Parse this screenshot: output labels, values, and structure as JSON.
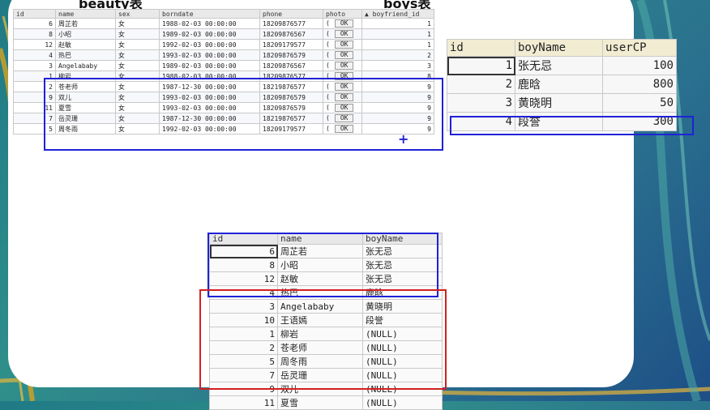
{
  "colors": {
    "highlight_blue": "#1f22d6",
    "highlight_red": "#d42020",
    "marker": "#1f22d6"
  },
  "captions": {
    "beauty": "beauty表",
    "boys": "boys表"
  },
  "beauty_table": {
    "headers": [
      "id",
      "name",
      "sex",
      "borndate",
      "phone",
      "photo",
      "boyfriend_id"
    ],
    "sort_indicator": "▲",
    "photo_button": "OK",
    "photo_prefix": "(",
    "rows": [
      [
        "6",
        "周芷若",
        "女",
        "1988-02-03 00:00:00",
        "18209876577",
        "1"
      ],
      [
        "8",
        "小昭",
        "女",
        "1989-02-03 00:00:00",
        "18209876567",
        "1"
      ],
      [
        "12",
        "赵敏",
        "女",
        "1992-02-03 00:00:00",
        "18209179577",
        "1"
      ],
      [
        "4",
        "热巴",
        "女",
        "1993-02-03 00:00:00",
        "18209876579",
        "2"
      ],
      [
        "3",
        "Angelababy",
        "女",
        "1989-02-03 00:00:00",
        "18209876567",
        "3"
      ],
      [
        "1",
        "柳岩",
        "女",
        "1988-02-03 00:00:00",
        "18209876577",
        "8"
      ],
      [
        "2",
        "苍老师",
        "女",
        "1987-12-30 00:00:00",
        "18219876577",
        "9"
      ],
      [
        "9",
        "双儿",
        "女",
        "1993-02-03 00:00:00",
        "18209876579",
        "9"
      ],
      [
        "11",
        "夏雪",
        "女",
        "1993-02-03 00:00:00",
        "18209876579",
        "9"
      ],
      [
        "7",
        "岳灵珊",
        "女",
        "1987-12-30 00:00:00",
        "18219876577",
        "9"
      ],
      [
        "5",
        "周冬雨",
        "女",
        "1992-02-03 00:00:00",
        "18209179577",
        "9"
      ]
    ],
    "marker": "+"
  },
  "boys_table": {
    "headers": [
      "id",
      "boyName",
      "userCP"
    ],
    "rows": [
      [
        "1",
        "张无忌",
        "100"
      ],
      [
        "2",
        "鹿晗",
        "800"
      ],
      [
        "3",
        "黄晓明",
        "50"
      ],
      [
        "4",
        "段誉",
        "300"
      ]
    ]
  },
  "result_table": {
    "headers": [
      "id",
      "name",
      "boyName"
    ],
    "rows": [
      [
        "6",
        "周芷若",
        "张无忌"
      ],
      [
        "8",
        "小昭",
        "张无忌"
      ],
      [
        "12",
        "赵敏",
        "张无忌"
      ],
      [
        "4",
        "热巴",
        "鹿晗"
      ],
      [
        "3",
        "Angelababy",
        "黄晓明"
      ],
      [
        "10",
        "王语嫣",
        "段誉"
      ],
      [
        "1",
        "柳岩",
        "(NULL)"
      ],
      [
        "2",
        "苍老师",
        "(NULL)"
      ],
      [
        "5",
        "周冬雨",
        "(NULL)"
      ],
      [
        "7",
        "岳灵珊",
        "(NULL)"
      ],
      [
        "9",
        "双儿",
        "(NULL)"
      ],
      [
        "11",
        "夏雪",
        "(NULL)"
      ]
    ]
  }
}
